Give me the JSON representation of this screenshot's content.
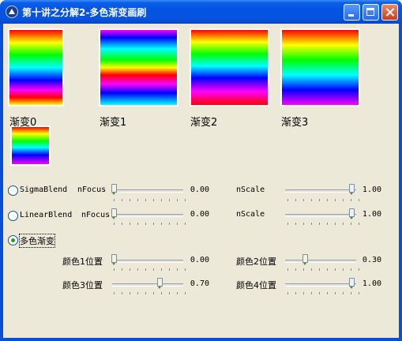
{
  "window": {
    "title": "第十讲之分解2-多色渐变画刷",
    "icon": "app-icon"
  },
  "swatches": [
    {
      "label": "渐变0"
    },
    {
      "label": "渐变1"
    },
    {
      "label": "渐变2"
    },
    {
      "label": "渐变3"
    }
  ],
  "sigma": {
    "label": "SigmaBlend",
    "focus_label": "nFocus",
    "focus_value": "0.00",
    "scale_label": "nScale",
    "scale_value": "1.00",
    "selected": false
  },
  "linear": {
    "label": "LinearBlend",
    "focus_label": "nFocus",
    "focus_value": "0.00",
    "scale_label": "nScale",
    "scale_value": "1.00",
    "selected": false
  },
  "multi": {
    "label": "多色渐变",
    "selected": true,
    "pos1_label": "颜色1位置",
    "pos1_value": "0.00",
    "pos2_label": "颜色2位置",
    "pos2_value": "0.30",
    "pos3_label": "颜色3位置",
    "pos3_value": "0.70",
    "pos4_label": "颜色4位置",
    "pos4_value": "1.00"
  }
}
